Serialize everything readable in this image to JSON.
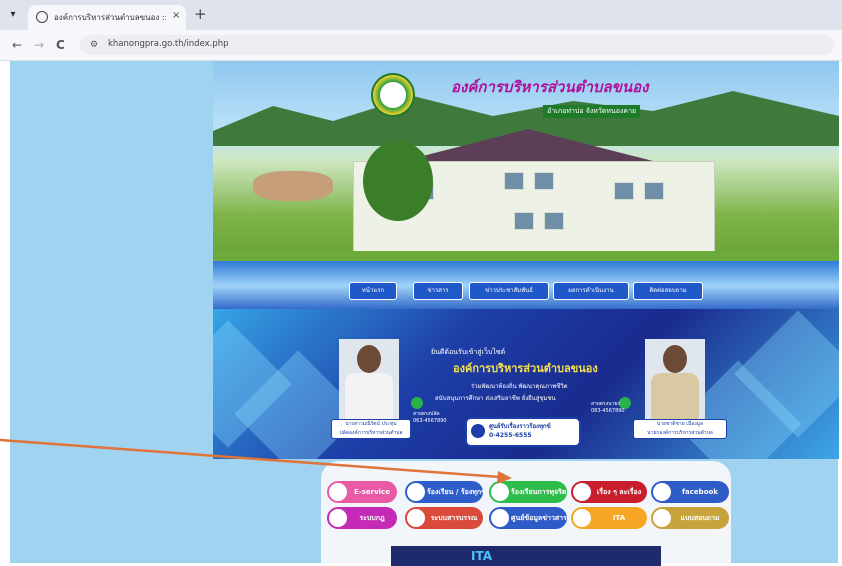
{
  "browser": {
    "tab": {
      "title": "องค์การบริหารส่วนตำบลขนอง :: ",
      "close_glyph": "×"
    },
    "new_tab_glyph": "+",
    "nav": {
      "back": "←",
      "forward": "→",
      "reload": "C"
    },
    "url": "khanongpra.go.th/index.php"
  },
  "site": {
    "logo_title": "องค์การบริหารส่วนตำบลขนอง",
    "logo_subtitle": "อำเภอท่าบ่อ จังหวัดหนองคาย",
    "menu": [
      "หน้าแรก",
      "ข่าวสาร",
      "ข่าวประชาสัมพันธ์",
      "ผลการดำเนินงาน",
      "ติดต่อสอบถาม"
    ],
    "mid_banner": {
      "caption": "ยินดีต้อนรับเข้าสู่เว็บไซต์",
      "title": "องค์การบริหารส่วนตำบลขนอง",
      "quote_line1": "ร่วมพัฒนาท้องถิ่น พัฒนาคุณภาพชีวิต",
      "quote_line2": "สนับสนุนการศึกษา ส่งเสริมอาชีพ ยั่งยืนสู่ชุมชน",
      "left_name": "นางสาวมณีรัตน์ ประทุม",
      "left_role": "ปลัดองค์การบริหารส่วนตำบล",
      "left_phone_label": "สายตรงปลัด",
      "left_phone": "063-4567890",
      "right_name": "นายชาติชาย เมืองมูล",
      "right_role": "นายกองค์การบริหารส่วนตำบล",
      "right_phone_label": "สายตรงนายก",
      "right_phone": "083-4567890",
      "center_label": "ศูนย์รับเรื่องราวร้องทุกข์",
      "center_phone": "0-4255-6555"
    },
    "services": [
      {
        "label": "E-service",
        "color": "#e95aa6"
      },
      {
        "label": "ร้องเรียน / ร้องทุกข์",
        "color": "#2e5cc9"
      },
      {
        "label": "ร้องเรียนการทุจริต",
        "color": "#2ebd4a"
      },
      {
        "label": "เรื่อง ๆ ละเรื่อง",
        "color": "#c81e2e"
      },
      {
        "label": "facebook",
        "color": "#2f5bc7"
      },
      {
        "label": "ระบบกฎ",
        "color": "#c42ab6"
      },
      {
        "label": "ระบบสารบรรณ",
        "color": "#d94a3b"
      },
      {
        "label": "ศูนย์ข้อมูลข่าวสาร",
        "color": "#2f5bc7"
      },
      {
        "label": "ITA",
        "color": "#f5a623"
      },
      {
        "label": "แบบสอบถาม",
        "color": "#c8a23a"
      }
    ],
    "bottom_banner": "ITA"
  }
}
